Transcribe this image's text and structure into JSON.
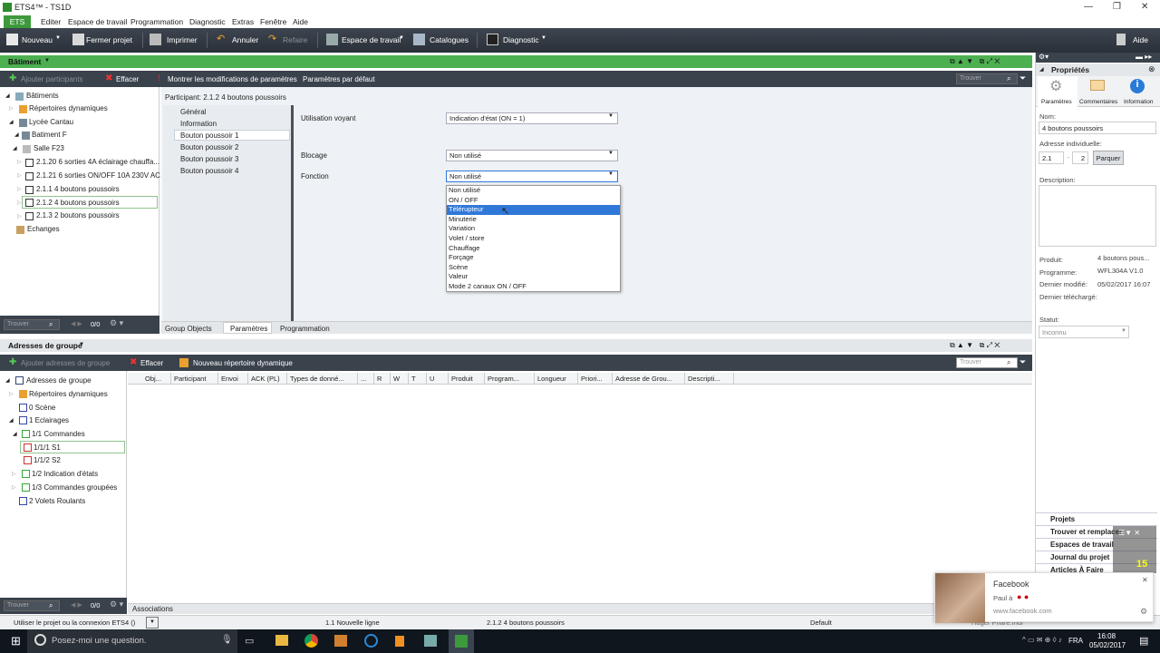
{
  "window": {
    "title": "ETS4™ - TS1D"
  },
  "menu": {
    "ets": "ETS",
    "items": [
      "Editer",
      "Espace de travail",
      "Programmation",
      "Diagnostic",
      "Extras",
      "Fenêtre",
      "Aide"
    ]
  },
  "toolbar": {
    "nouveau": "Nouveau",
    "fermer": "Fermer projet",
    "imprimer": "Imprimer",
    "annuler": "Annuler",
    "refaire": "Refaire",
    "espace": "Espace de travail",
    "catalogues": "Catalogues",
    "diagnostic": "Diagnostic",
    "aide": "Aide"
  },
  "batiment": {
    "title": "Bâtiment",
    "add": "Ajouter participants",
    "effacer": "Effacer",
    "show_mods": "Montrer les modifications de paramètres",
    "defaults": "Paramètres par défaut",
    "search_ph": "Trouver",
    "count": "0/0",
    "tree": [
      "Bâtiments",
      "Répertoires dynamiques",
      "Lycée Cantau",
      "Batiment F",
      "Salle F23",
      "2.1.20  6 sorties 4A éclairage chauffa...",
      "2.1.21  6 sorties ON/OFF 10A 230V AC",
      "2.1.1  4 boutons poussoirs",
      "2.1.2  4 boutons poussoirs",
      "2.1.3  2 boutons poussoirs",
      "Echanges"
    ]
  },
  "participant": {
    "header": "Participant: 2.1.2  4 boutons poussoirs",
    "nav": [
      "Général",
      "Information",
      "Bouton poussoir 1",
      "Bouton poussoir 2",
      "Bouton poussoir 3",
      "Bouton poussoir 4"
    ],
    "params": [
      {
        "label": "Utilisation voyant",
        "value": "Indication d'état (ON = 1)"
      },
      {
        "label": "Blocage",
        "value": "Non utilisé"
      },
      {
        "label": "Fonction",
        "value": "Non utilisé"
      }
    ],
    "options": [
      "Non utilisé",
      "ON / OFF",
      "Télérupteur",
      "Minuterie",
      "Variation",
      "Volet / store",
      "Chauffage",
      "Forçage",
      "Scène",
      "Valeur",
      "Mode 2 canaux ON / OFF"
    ],
    "tabs": [
      "Group Objects",
      "Paramètres",
      "Programmation"
    ]
  },
  "groups": {
    "title": "Adresses de groupe",
    "add": "Ajouter adresses de groupe",
    "effacer": "Effacer",
    "new_dir": "Nouveau répertoire dynamique",
    "search_ph": "Trouver",
    "count": "0/0",
    "assoc": "Associations",
    "tree": [
      "Adresses de groupe",
      "Répertoires dynamiques",
      "0 Scène",
      "1 Eclairages",
      "1/1 Commandes",
      "1/1/1 S1",
      "1/1/2 S2",
      "1/2 Indication d'états",
      "1/3 Commandes groupées",
      "2 Volets Roulants"
    ],
    "columns": [
      "Obj...",
      "Participant",
      "Envoi",
      "ACK (PL)",
      "Types de donné...",
      "...",
      "R",
      "W",
      "T",
      "U",
      "Produit",
      "Program...",
      "Longueur",
      "Priori...",
      "Adresse de Grou...",
      "Descripti..."
    ]
  },
  "props": {
    "title": "Propriétés",
    "tabs": [
      "Paramètres",
      "Commentaires",
      "Information"
    ],
    "nom_label": "Nom:",
    "nom": "4 boutons poussoirs",
    "addr_label": "Adresse individuelle:",
    "addr1": "2.1",
    "addr2": "2",
    "parquer": "Parquer",
    "desc_label": "Description:",
    "info": [
      [
        "Produit:",
        "4 boutons pous..."
      ],
      [
        "Programme:",
        "WFL304A V1.0"
      ],
      [
        "Dernier modifié:",
        "05/02/2017 16:07"
      ],
      [
        "Dernier téléchargé:",
        ""
      ]
    ],
    "statut_label": "Statut:",
    "statut": "Inconnu",
    "accordion": [
      "Projets",
      "Trouver et remplacer",
      "Espaces de travail",
      "Journal du projet",
      "Articles À Faire"
    ]
  },
  "status": {
    "conn": "Utiliser le projet ou la connexion ETS4 ()",
    "ligne": "1.1 Nouvelle ligne",
    "part": "2.1.2  4 boutons poussoirs",
    "default": "Default",
    "hager": "Hager Phare.mdr"
  },
  "notif": {
    "app": "Facebook",
    "text": "Paul à",
    "url": "www.facebook.com",
    "badge": "15"
  },
  "taskbar": {
    "search": "Posez-moi une question.",
    "lang": "FRA",
    "time": "16:08",
    "date": "05/02/2017"
  }
}
